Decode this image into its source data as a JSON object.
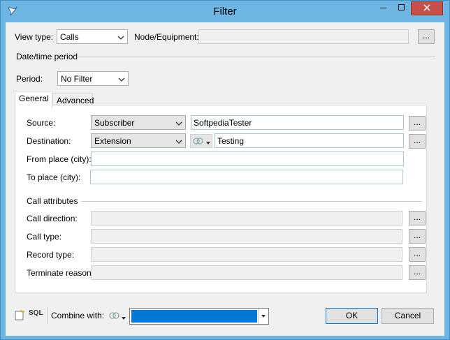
{
  "window": {
    "title": "Filter"
  },
  "header": {
    "view_type_label": "View type:",
    "view_type_value": "Calls",
    "node_label": "Node/Equipment:",
    "node_value": "",
    "browse_label": "...",
    "datetime_section": "Date/time period",
    "period_label": "Period:",
    "period_value": "No Filter"
  },
  "tabs": [
    {
      "label": "General",
      "active": true
    },
    {
      "label": "Advanced",
      "active": false
    }
  ],
  "general": {
    "source_label": "Source:",
    "source_type": "Subscriber",
    "source_value": "SoftpediaTester",
    "destination_label": "Destination:",
    "destination_type": "Extension",
    "destination_value": "Testing",
    "from_place_label": "From place (city):",
    "from_place_value": "",
    "to_place_label": "To place (city):",
    "to_place_value": "",
    "call_attributes_section": "Call attributes",
    "call_direction_label": "Call direction:",
    "call_type_label": "Call type:",
    "record_type_label": "Record type:",
    "terminate_reason_label": "Terminate reason:",
    "browse_label": "..."
  },
  "footer": {
    "sql_label": "SQL",
    "combine_label": "Combine with:",
    "ok_label": "OK",
    "cancel_label": "Cancel"
  },
  "colors": {
    "title_bar": "#6db6e4",
    "close_button": "#c7504b",
    "selection": "#0078d7"
  },
  "icons": [
    "app-icon",
    "minimize-icon",
    "maximize-icon",
    "close-icon",
    "chevron-down-icon",
    "link-icon",
    "new-filter-icon",
    "sql-icon"
  ]
}
